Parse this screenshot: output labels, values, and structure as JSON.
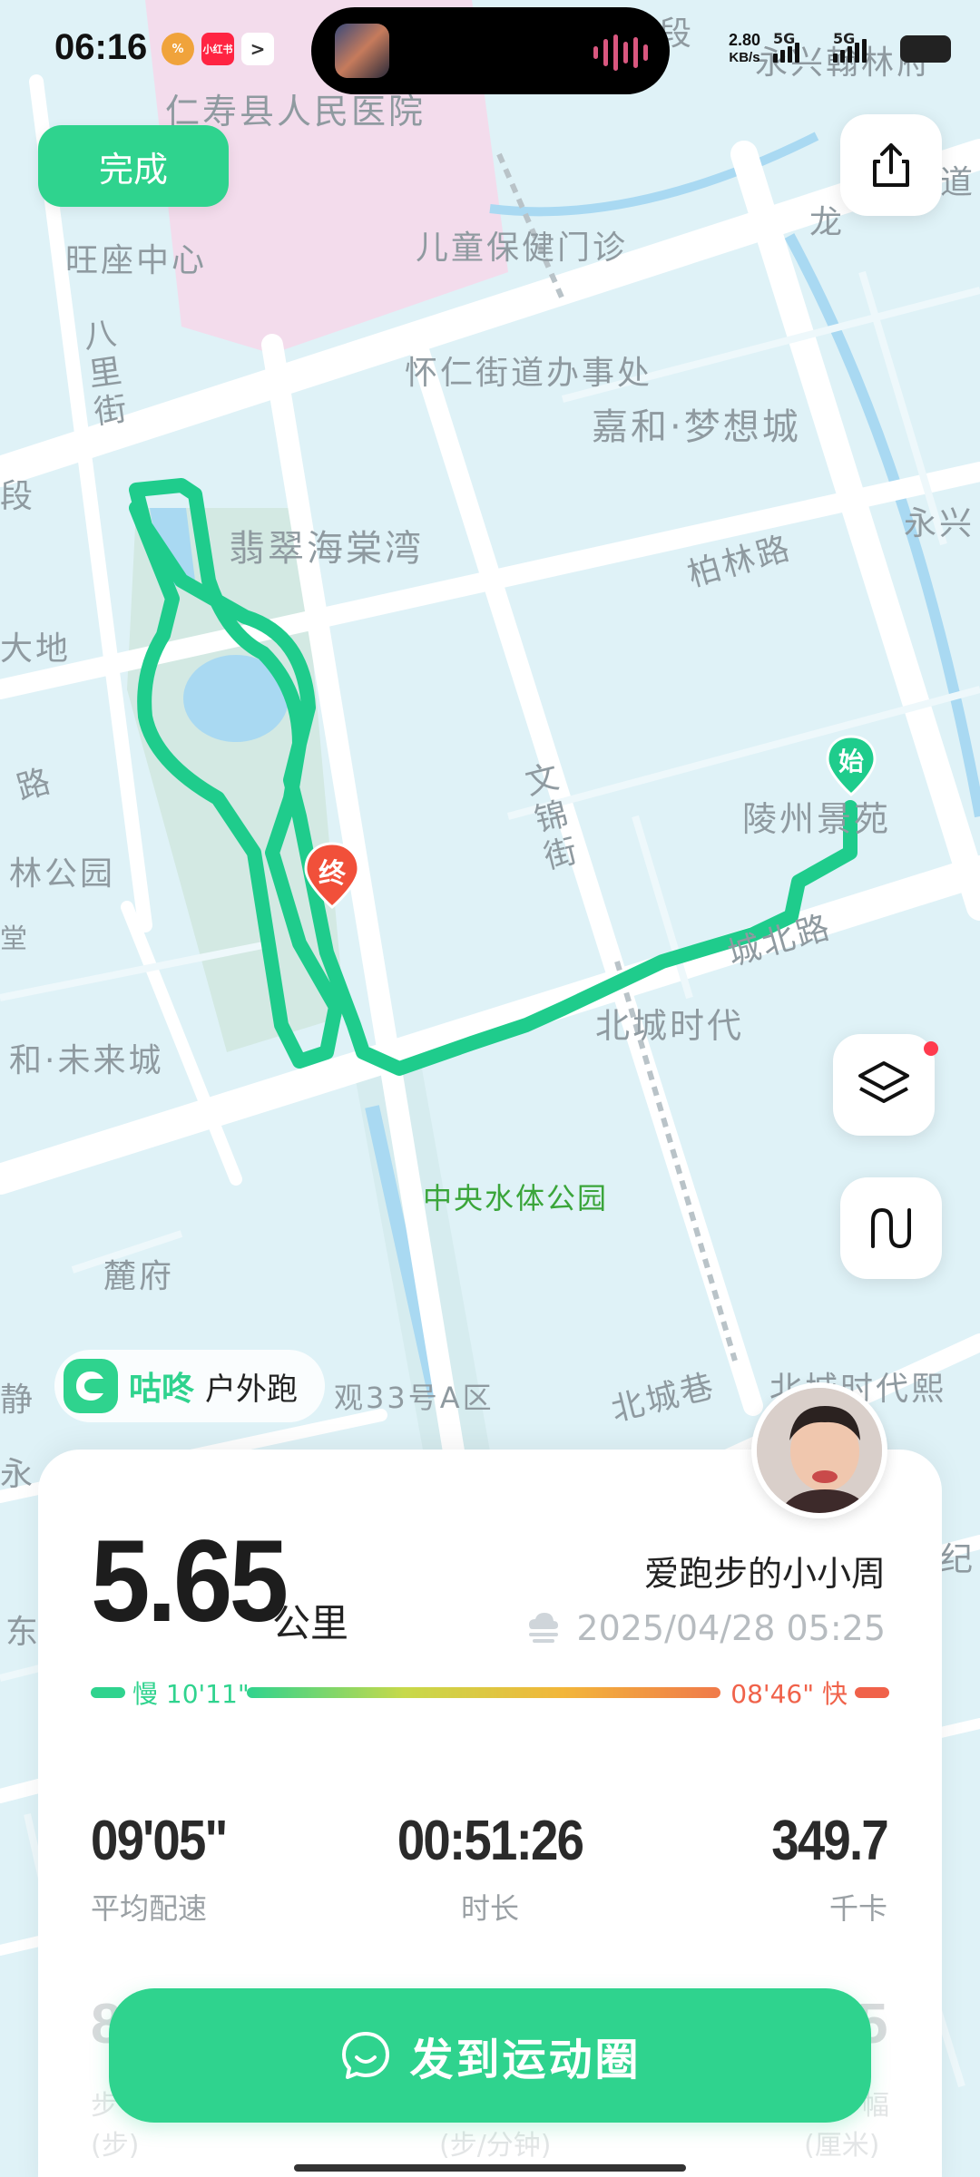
{
  "status_bar": {
    "time": "06:16",
    "net_speed_value": "2.80",
    "net_speed_unit": "KB/s",
    "signal_1": "5G",
    "signal_2": "5G",
    "app_icons": [
      "xiaohongshu-app-icon",
      "promo-app-icon",
      "arrow-app-icon"
    ]
  },
  "top": {
    "done_label": "完成"
  },
  "map": {
    "labels": {
      "hospital": "仁寿县人民医院",
      "child_care": "儿童保健门诊",
      "wangzuo": "旺座中心",
      "bali_street": "八里街",
      "huairen": "怀仁街道办事处",
      "jiahe_mengxiang": "嘉和·梦想城",
      "feicui": "翡翠海棠湾",
      "bailin_road": "柏林路",
      "yongxing": "永兴",
      "dadi": "大地",
      "road_left": "路",
      "lin_park": "林公园",
      "wenjin_street": "文锦街",
      "lingzhou": "陵州景苑",
      "beicheng_road": "城北路",
      "beicheng_shidai": "北城时代",
      "hanglin": "永兴翰林府",
      "long": "龙",
      "dao": "道",
      "jiahe_weilai": "和·未来城",
      "tang": "堂",
      "duan_left": "段",
      "duan_top": "段",
      "central_park": "中央水体公园",
      "lufu": "麓府",
      "jing": "静",
      "yong": "永",
      "guan33": "观33号A区",
      "beicheng_xiang": "北城巷",
      "beicheng_shidaixi": "北城时代熙",
      "ji": "纪",
      "dong": "东"
    },
    "start_marker": "始",
    "end_marker": "终",
    "route_color": "#1fcc8c"
  },
  "brand": {
    "name": "咕咚",
    "sport": "户外跑"
  },
  "card": {
    "distance": "5.65",
    "distance_unit": "公里",
    "username": "爱跑步的小小周",
    "datetime": "2025/04/28 05:25",
    "pace_slow": "慢 10'11\"",
    "pace_fast": "08'46\" 快",
    "stats": [
      {
        "value": "09'05\"",
        "label": "平均配速"
      },
      {
        "value": "00:51:26",
        "label": "时长"
      },
      {
        "value": "349.7",
        "label": "千卡"
      }
    ],
    "share_label": "发到运动圈",
    "hidden_row": {
      "left_value": "8",
      "right_value": "5",
      "left_label": "步",
      "left_unit": "(步)",
      "mid_unit": "(步/分钟)",
      "right_label": "幅",
      "right_unit": "(厘米)"
    }
  },
  "colors": {
    "accent": "#2fd38e",
    "fast": "#f0624a",
    "end_marker": "#f1503a"
  }
}
